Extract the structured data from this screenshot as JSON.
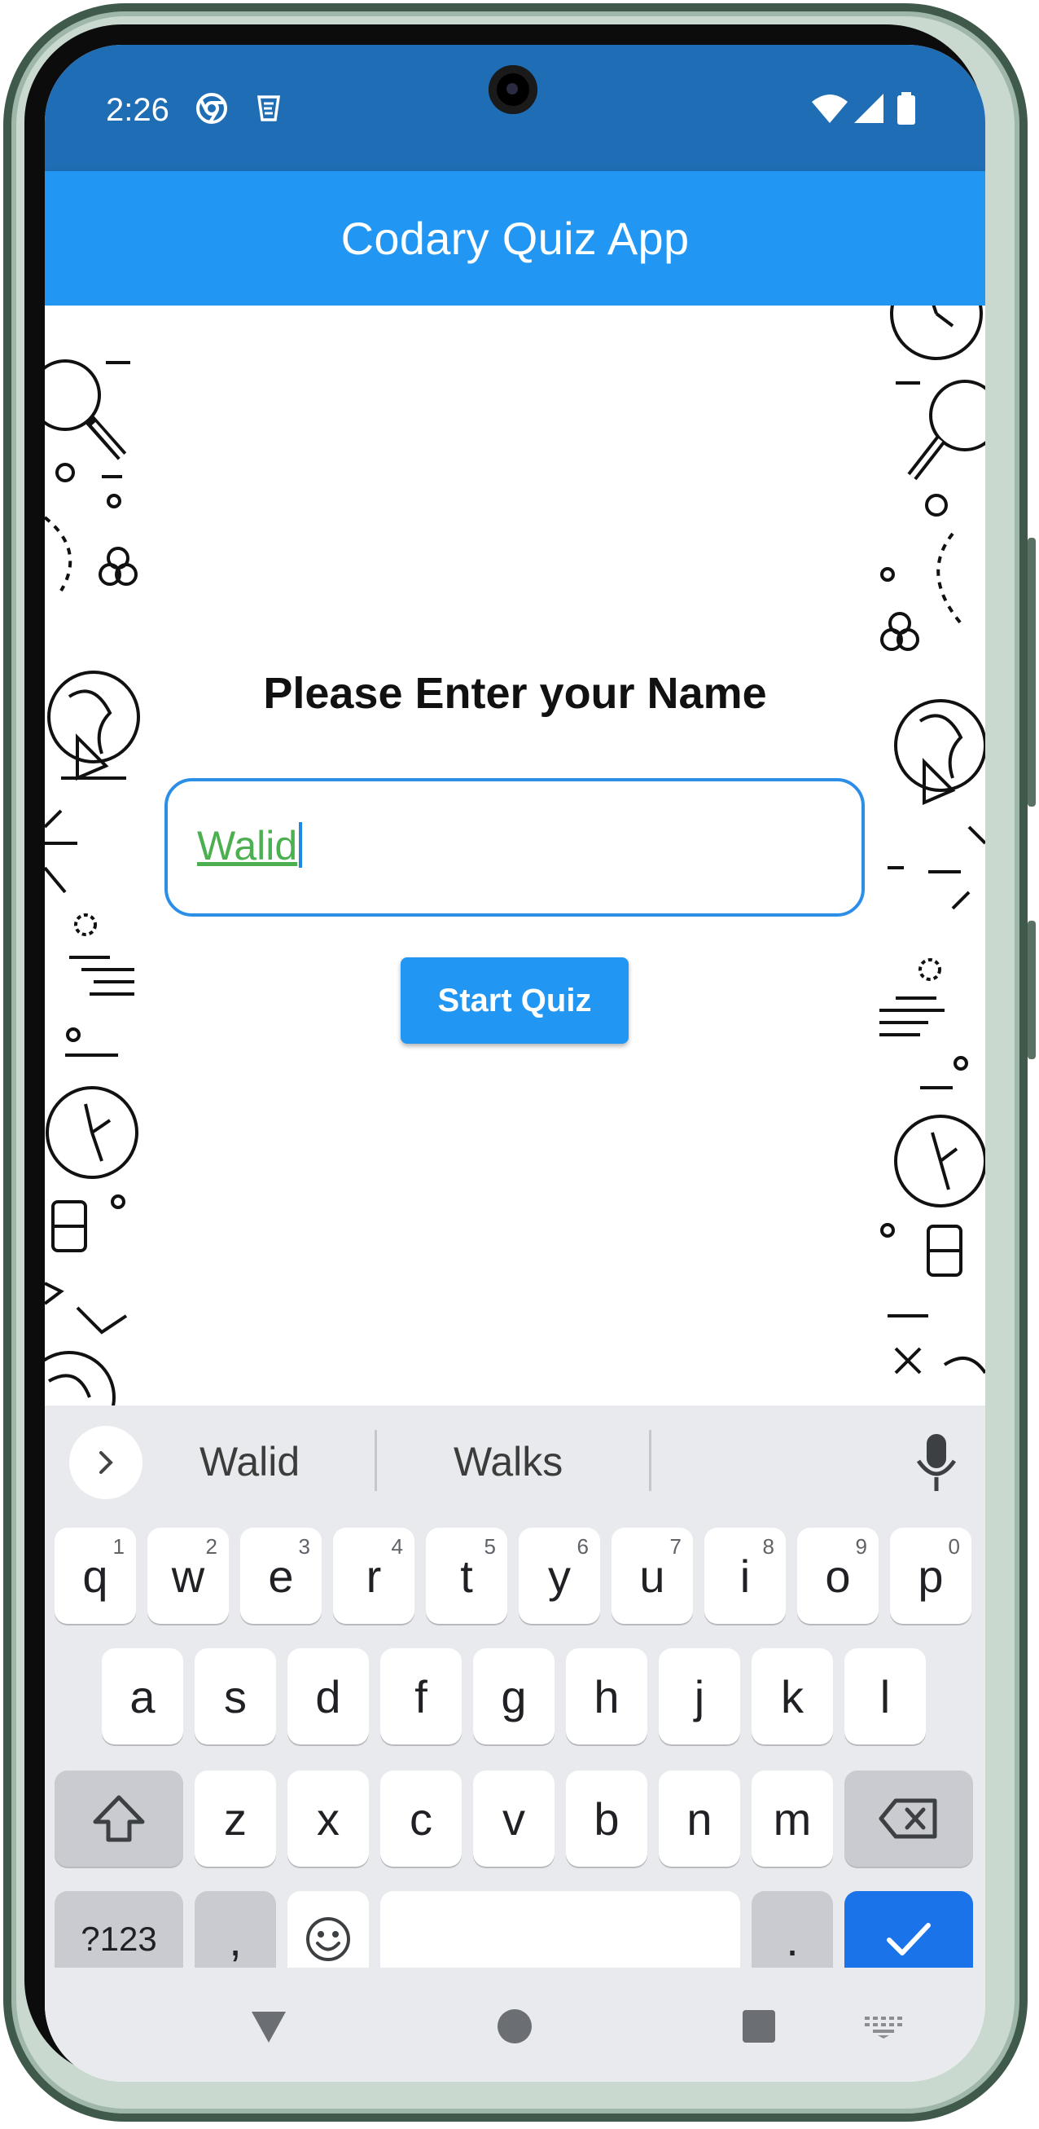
{
  "status_bar": {
    "time": "2:26",
    "icons": [
      "chrome-icon",
      "app-notification-icon",
      "wifi-icon",
      "signal-icon",
      "battery-icon"
    ]
  },
  "app_bar": {
    "title": "Codary Quiz App",
    "color": "#2196f3"
  },
  "form": {
    "prompt": "Please Enter your Name",
    "name_value": "Walid",
    "start_button_label": "Start Quiz"
  },
  "keyboard": {
    "suggestions": [
      "Walid",
      "Walks"
    ],
    "row1": [
      {
        "key": "q",
        "hint": "1"
      },
      {
        "key": "w",
        "hint": "2"
      },
      {
        "key": "e",
        "hint": "3"
      },
      {
        "key": "r",
        "hint": "4"
      },
      {
        "key": "t",
        "hint": "5"
      },
      {
        "key": "y",
        "hint": "6"
      },
      {
        "key": "u",
        "hint": "7"
      },
      {
        "key": "i",
        "hint": "8"
      },
      {
        "key": "o",
        "hint": "9"
      },
      {
        "key": "p",
        "hint": "0"
      }
    ],
    "row2": [
      "a",
      "s",
      "d",
      "f",
      "g",
      "h",
      "j",
      "k",
      "l"
    ],
    "row3": [
      "z",
      "x",
      "c",
      "v",
      "b",
      "n",
      "m"
    ],
    "symbols_label": "?123",
    "comma_label": ",",
    "period_label": ".",
    "accent_color": "#1a73e8"
  },
  "navigation": [
    "back-icon",
    "home-icon",
    "recents-icon",
    "keyboard-switch-icon"
  ]
}
